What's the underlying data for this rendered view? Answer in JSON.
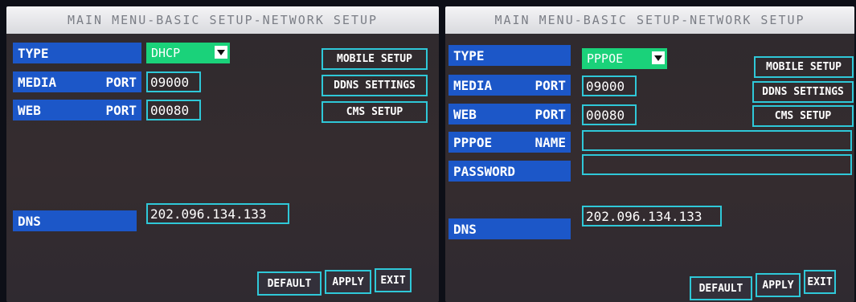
{
  "left": {
    "title": "MAIN MENU-BASIC SETUP-NETWORK SETUP",
    "type_label": "TYPE",
    "type_value": "DHCP",
    "media_label": "MEDIA",
    "media_port": "PORT",
    "media_value": "09000",
    "web_label": "WEB",
    "web_port": "PORT",
    "web_value": "00080",
    "dns_label": "DNS",
    "dns_value": "202.096.134.133",
    "mobile_button": "MOBILE SETUP",
    "ddns_button": "DDNS SETTINGS",
    "cms_button": "CMS SETUP",
    "default_button": "DEFAULT",
    "apply_button": "APPLY",
    "exit_button": "EXIT"
  },
  "right": {
    "title": "MAIN MENU-BASIC SETUP-NETWORK SETUP",
    "type_label": "TYPE",
    "type_value": "PPPOE",
    "media_label": "MEDIA",
    "media_port": "PORT",
    "media_value": "09000",
    "web_label": "WEB",
    "web_port": "PORT",
    "web_value": "00080",
    "pppoe_label": "PPPOE",
    "pppoe_name": "NAME",
    "pppoe_value": "",
    "password_label": "PASSWORD",
    "password_value": "",
    "dns_label": "DNS",
    "dns_value": "202.096.134.133",
    "mobile_button": "MOBILE SETUP",
    "ddns_button": "DDNS SETTINGS",
    "cms_button": "CMS SETUP",
    "default_button": "DEFAULT",
    "apply_button": "APPLY",
    "exit_button": "EXIT"
  },
  "colors": {
    "label_bg": "#1c57c8",
    "field_border": "#2fc8d8",
    "dropdown_bg": "#1ad27a"
  }
}
